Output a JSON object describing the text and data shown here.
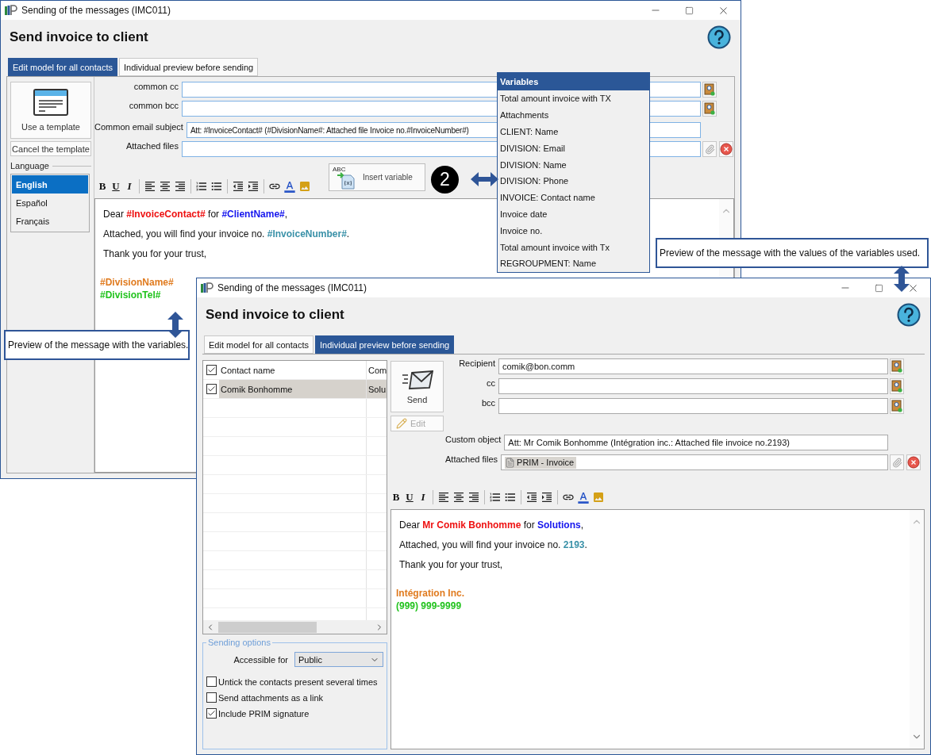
{
  "edit_window": {
    "title": "Sending of the messages (IMC011)",
    "heading": "Send invoice to client",
    "tabs": [
      {
        "label": "Edit model for all contacts",
        "selected": true
      },
      {
        "label": "Individual preview before sending",
        "selected": false
      }
    ],
    "template_button": "Use a template",
    "cancel_template_button": "Cancel the template",
    "language": {
      "label": "Language",
      "items": [
        {
          "label": "English",
          "selected": true
        },
        {
          "label": "Español",
          "selected": false
        },
        {
          "label": "Français",
          "selected": false
        }
      ]
    },
    "fields": [
      {
        "kind": "address",
        "label": "common cc"
      },
      {
        "kind": "address",
        "label": "common bcc"
      },
      {
        "kind": "subject",
        "label": "Common email subject",
        "value": "Att: #InvoiceContact# (#DivisionName#: Attached file Invoice no.#InvoiceNumber#)"
      },
      {
        "kind": "files",
        "label": "Attached files"
      }
    ],
    "toolbar": [
      {
        "kind": "bold",
        "label": "B"
      },
      {
        "kind": "underline",
        "label": "U"
      },
      {
        "kind": "italic",
        "label": "I"
      },
      {
        "kind": "separator"
      },
      {
        "kind": "align-left"
      },
      {
        "kind": "align-center"
      },
      {
        "kind": "align-right"
      },
      {
        "kind": "separator"
      },
      {
        "kind": "numbered-list"
      },
      {
        "kind": "bullet-list"
      },
      {
        "kind": "separator"
      },
      {
        "kind": "outdent"
      },
      {
        "kind": "indent"
      },
      {
        "kind": "separator"
      },
      {
        "kind": "link"
      },
      {
        "kind": "font-color"
      },
      {
        "kind": "image"
      }
    ],
    "insert_variable": {
      "icon_text": "ABC",
      "label": "Insert variable"
    },
    "message": [
      {
        "segments": [
          {
            "text": "Dear "
          },
          {
            "text": "#InvoiceContact#",
            "color": "#ee1111"
          },
          {
            "text": " for "
          },
          {
            "text": "#ClientName#",
            "color": "#1515ee"
          },
          {
            "text": ","
          }
        ]
      },
      {
        "segments": [
          {
            "text": "Attached, you will find your invoice no. "
          },
          {
            "text": "#InvoiceNumber#",
            "color": "#3a91a8"
          },
          {
            "text": "."
          }
        ]
      },
      {
        "segments": [
          {
            "text": "Thank you for your trust,"
          }
        ]
      }
    ],
    "signature": [
      {
        "segments": [
          {
            "text": "#DivisionName#",
            "color": "#e07b1f"
          }
        ]
      },
      {
        "segments": [
          {
            "text": "#DivisionTel#",
            "color": "#22c31e"
          }
        ]
      }
    ]
  },
  "variables_popup": {
    "title": "Variables",
    "items": [
      "Total amount invoice with TX",
      "Attachments",
      "CLIENT: Name",
      "DIVISION: Email",
      "DIVISION: Name",
      "DIVISION: Phone",
      "INVOICE: Contact name",
      "Invoice date",
      "Invoice no.",
      "Total amount invoice with Tx",
      "REGROUPMENT: Name"
    ]
  },
  "annotations": [
    {
      "kind": "step",
      "text": "2"
    },
    {
      "kind": "note",
      "text": "Preview of the message with the values of the variables used."
    },
    {
      "kind": "note",
      "text": "Preview of the message with the variables."
    }
  ],
  "preview_window": {
    "title": "Sending of the messages (IMC011)",
    "heading": "Send invoice to client",
    "tabs": [
      {
        "label": "Edit model for all contacts",
        "selected": false
      },
      {
        "label": "Individual preview before sending",
        "selected": true
      }
    ],
    "contacts": {
      "columns": [
        {
          "label": "Contact name",
          "checked": true
        },
        {
          "label": "Com"
        }
      ],
      "rows": [
        {
          "cells": [
            "Comik Bonhomme",
            "Solu"
          ],
          "checked": true,
          "selected": true
        }
      ]
    },
    "sending_options": {
      "title": "Sending options",
      "accessible_for": {
        "label": "Accessible for",
        "value": "Public"
      },
      "options": [
        {
          "label": "Untick the contacts present several times",
          "checked": false
        },
        {
          "label": "Send attachments as a link",
          "checked": false
        },
        {
          "label": "Include PRIM signature",
          "checked": true
        }
      ]
    },
    "send_button": "Send",
    "edit_button": {
      "label": "Edit",
      "disabled": true
    },
    "fields": [
      {
        "kind": "address",
        "label": "Recipient",
        "value": "comik@bon.comm"
      },
      {
        "kind": "address",
        "label": "cc"
      },
      {
        "kind": "address",
        "label": "bcc"
      },
      {
        "kind": "subject",
        "label": "Custom object",
        "value": "Att: Mr Comik Bonhomme (Intégration inc.: Attached file invoice no.2193)"
      },
      {
        "kind": "files",
        "label": "Attached files",
        "attachment": "PRIM - Invoice"
      }
    ],
    "toolbar": [
      {
        "kind": "bold",
        "label": "B"
      },
      {
        "kind": "underline",
        "label": "U"
      },
      {
        "kind": "italic",
        "label": "I"
      },
      {
        "kind": "separator"
      },
      {
        "kind": "align-left"
      },
      {
        "kind": "align-center"
      },
      {
        "kind": "align-right"
      },
      {
        "kind": "separator"
      },
      {
        "kind": "numbered-list"
      },
      {
        "kind": "bullet-list"
      },
      {
        "kind": "separator"
      },
      {
        "kind": "outdent"
      },
      {
        "kind": "indent"
      },
      {
        "kind": "separator"
      },
      {
        "kind": "link"
      },
      {
        "kind": "font-color"
      },
      {
        "kind": "image"
      }
    ],
    "message": [
      {
        "segments": [
          {
            "text": "Dear "
          },
          {
            "text": "Mr Comik Bonhomme",
            "color": "#ee1111"
          },
          {
            "text": " for "
          },
          {
            "text": "Solutions",
            "color": "#1515ee"
          },
          {
            "text": ","
          }
        ]
      },
      {
        "segments": [
          {
            "text": "Attached, you will find your invoice no. "
          },
          {
            "text": "2193",
            "color": "#3a91a8"
          },
          {
            "text": "."
          }
        ]
      },
      {
        "segments": [
          {
            "text": "Thank you for your trust,"
          }
        ]
      }
    ],
    "signature": [
      {
        "segments": [
          {
            "text": "Intégration Inc.",
            "color": "#e07b1f"
          }
        ]
      },
      {
        "segments": [
          {
            "text": "(999) 999-9999",
            "color": "#22c31e"
          }
        ]
      }
    ]
  }
}
